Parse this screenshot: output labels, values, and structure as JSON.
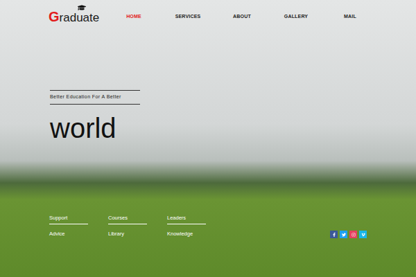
{
  "logo": {
    "initial": "G",
    "rest": "raduate"
  },
  "nav": [
    {
      "label": "HOME",
      "selected": true
    },
    {
      "label": "SERVICES",
      "selected": false
    },
    {
      "label": "ABOUT",
      "selected": false
    },
    {
      "label": "GALLERY",
      "selected": false
    },
    {
      "label": "MAIL",
      "selected": false
    }
  ],
  "hero": {
    "tagline": "Better Education For A Better",
    "headline": "world"
  },
  "links": [
    [
      "Support",
      "Courses",
      "Leaders"
    ],
    [
      "Advice",
      "Library",
      "Knowledge"
    ]
  ],
  "social": [
    {
      "kind": "facebook",
      "color": "#3b5998"
    },
    {
      "kind": "twitter",
      "color": "#1da1f2"
    },
    {
      "kind": "instagram",
      "color": "#e4405f"
    },
    {
      "kind": "vimeo",
      "color": "#1ab7ea"
    }
  ]
}
